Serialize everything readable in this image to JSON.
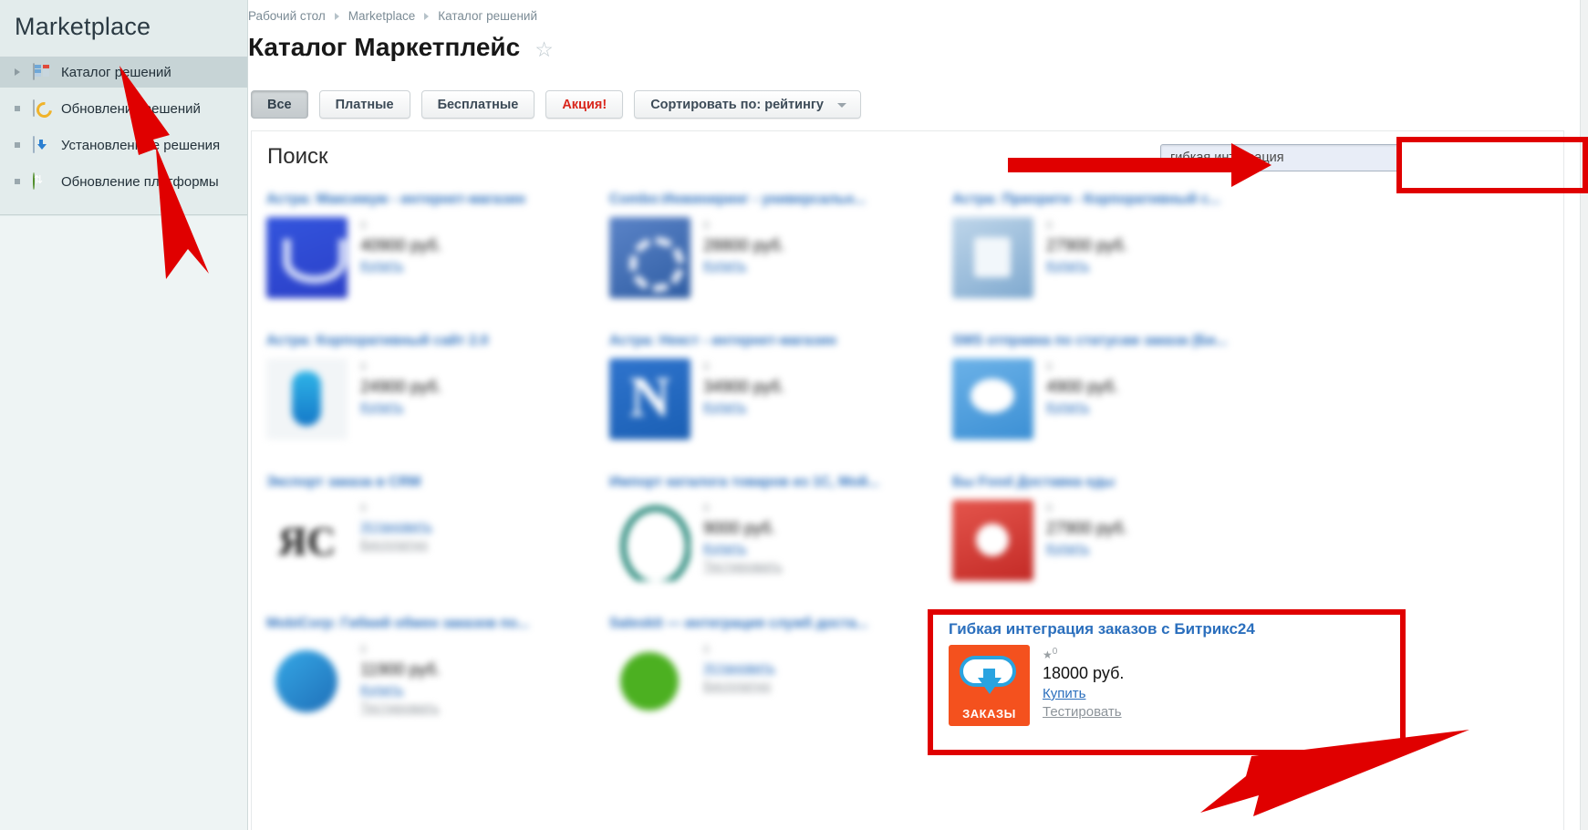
{
  "sidebar": {
    "brand": "Marketplace",
    "items": [
      {
        "label": "Каталог решений",
        "icon": "catalog-icon",
        "bullet": "triangle",
        "active": true
      },
      {
        "label": "Обновление решений",
        "icon": "update-solutions-icon",
        "bullet": "square",
        "active": false
      },
      {
        "label": "Установленные решения",
        "icon": "installed-icon",
        "bullet": "square",
        "active": false
      },
      {
        "label": "Обновление платформы",
        "icon": "platform-update-icon",
        "bullet": "square",
        "active": false
      }
    ]
  },
  "breadcrumb": [
    "Рабочий стол",
    "Marketplace",
    "Каталог решений"
  ],
  "header": {
    "title": "Каталог Маркетплейс",
    "favorite_icon": "☆"
  },
  "toolbar": {
    "buttons": [
      {
        "label": "Все",
        "selected": true,
        "style": "normal"
      },
      {
        "label": "Платные",
        "selected": false,
        "style": "normal"
      },
      {
        "label": "Бесплатные",
        "selected": false,
        "style": "normal"
      },
      {
        "label": "Акция!",
        "selected": false,
        "style": "promo"
      }
    ],
    "sort": {
      "label": "Сортировать по: рейтингу",
      "caret_icon": "chevron-down-icon"
    }
  },
  "search": {
    "label": "Поиск",
    "value": "гибкая интеграция",
    "placeholder": ""
  },
  "grid": {
    "rating_prefix": "★",
    "rows": [
      [
        {
          "title": "Астра: Максимум - интернет-магазин",
          "rating": "0",
          "price": "40900 руб.",
          "buy": "Купить",
          "trial": "",
          "logo": "logo-astra-max",
          "blurred": true
        },
        {
          "title": "Combo:Инжиниринг - универсальн...",
          "rating": "0",
          "price": "28800 руб.",
          "buy": "Купить",
          "trial": "",
          "logo": "logo-combo",
          "blurred": true
        },
        {
          "title": "Астра: Приорити - Корпоративный с...",
          "rating": "0",
          "price": "27900 руб.",
          "buy": "Купить",
          "trial": "",
          "logo": "logo-astra-present",
          "blurred": true
        }
      ],
      [
        {
          "title": "Астра: Корпоративный сайт 2.0",
          "rating": "0",
          "price": "24900 руб.",
          "buy": "Купить",
          "trial": "",
          "logo": "logo-astra-corp",
          "blurred": true
        },
        {
          "title": "Астра: Некст - интернет-магазин",
          "rating": "0",
          "price": "34900 руб.",
          "buy": "Купить",
          "trial": "",
          "logo": "logo-astra-next",
          "blurred": true
        },
        {
          "title": "SMS отправка по статусам заказа (Би...",
          "rating": "0",
          "price": "4900 руб.",
          "buy": "Купить",
          "trial": "",
          "logo": "logo-sms",
          "blurred": true
        }
      ],
      [
        {
          "title": "Экспорт заказа в CRM",
          "rating": "0",
          "price": "",
          "buy": "Установить",
          "trial": "Бесплатно",
          "logo": "logo-rc",
          "blurred": true
        },
        {
          "title": "Импорт каталога товаров из 1С, Мой...",
          "rating": "0",
          "price": "9000 руб.",
          "buy": "Купить",
          "trial": "Тестировать",
          "logo": "logo-1c",
          "blurred": true
        },
        {
          "title": "Бы Food Доставка еды",
          "rating": "0",
          "price": "27900 руб.",
          "buy": "Купить",
          "trial": "",
          "logo": "logo-food",
          "blurred": true
        }
      ],
      [
        {
          "title": "MobiCorp: Гибкий обмен заказов по...",
          "rating": "0",
          "price": "11900 руб.",
          "buy": "Купить",
          "trial": "Тестировать",
          "logo": "logo-mobiсorp",
          "blurred": true
        },
        {
          "title": "Saleskit — интеграция служб доста...",
          "rating": "0",
          "price": "",
          "buy": "Установить",
          "trial": "Бесплатно",
          "logo": "logo-saleskit",
          "blurred": true
        }
      ]
    ]
  },
  "highlight_card": {
    "title": "Гибкая интеграция заказов с Битрикс24",
    "rating_prefix": "★",
    "rating": "0",
    "price": "18000 руб.",
    "buy": "Купить",
    "trial": "Тестировать",
    "logo_label": "ЗАКАЗЫ",
    "logo_icon": "cloud-upload-download-icon"
  },
  "annotations": {
    "highlight_color": "#e00000",
    "arrow_to_sidebar_item": "Каталог решений",
    "arrow_to_search_field": "гибкая интеграция",
    "arrow_to_trial_link": "Тестировать"
  },
  "colors": {
    "sidebar_bg": "#e3ecec",
    "sidebar_active": "#c7d4d6",
    "link_blue": "#2b6fbd",
    "promo_red": "#d9261c",
    "annotation_red": "#e00000"
  }
}
